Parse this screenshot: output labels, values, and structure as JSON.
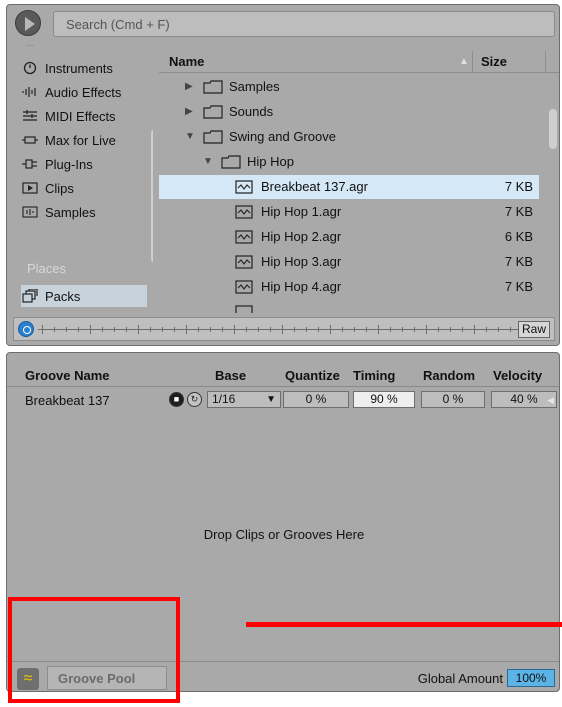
{
  "browser": {
    "search_placeholder": "Search (Cmd + F)",
    "sidebar": {
      "categories": [
        {
          "label": "Instruments",
          "icon": "clock-icon"
        },
        {
          "label": "Audio Effects",
          "icon": "waveform-icon"
        },
        {
          "label": "MIDI Effects",
          "icon": "midi-icon"
        },
        {
          "label": "Max for Live",
          "icon": "max-icon"
        },
        {
          "label": "Plug-Ins",
          "icon": "plug-icon"
        },
        {
          "label": "Clips",
          "icon": "clip-icon"
        },
        {
          "label": "Samples",
          "icon": "sample-icon"
        }
      ],
      "places_heading": "Places",
      "places": [
        {
          "label": "Packs",
          "icon": "packs-icon",
          "selected": true
        }
      ]
    },
    "list": {
      "col_name": "Name",
      "col_size": "Size",
      "rows": [
        {
          "label": "Samples",
          "type": "folder",
          "expanded": false
        },
        {
          "label": "Sounds",
          "type": "folder",
          "expanded": false
        },
        {
          "label": "Swing and Groove",
          "type": "folder",
          "expanded": true
        },
        {
          "label": "Hip Hop",
          "type": "folder",
          "expanded": true
        },
        {
          "label": "Breakbeat 137.agr",
          "type": "groove",
          "size": "7 KB",
          "selected": true
        },
        {
          "label": "Hip Hop 1.agr",
          "type": "groove",
          "size": "7 KB"
        },
        {
          "label": "Hip Hop 2.agr",
          "type": "groove",
          "size": "6 KB"
        },
        {
          "label": "Hip Hop 3.agr",
          "type": "groove",
          "size": "7 KB"
        },
        {
          "label": "Hip Hop 4.agr",
          "type": "groove",
          "size": "7 KB"
        }
      ]
    },
    "preview": {
      "raw_label": "Raw"
    }
  },
  "groove_pool": {
    "columns": {
      "name": "Groove Name",
      "base": "Base",
      "quantize": "Quantize",
      "timing": "Timing",
      "random": "Random",
      "velocity": "Velocity"
    },
    "rows": [
      {
        "name": "Breakbeat 137",
        "base": "1/16",
        "quantize": "0 %",
        "timing": "90 %",
        "random": "0 %",
        "velocity": "40 %"
      }
    ],
    "drop_text": "Drop Clips or Grooves Here",
    "footer": {
      "label": "Groove Pool",
      "global_amount_label": "Global Amount",
      "global_amount_value": "100%"
    }
  },
  "colors": {
    "panel": "#a9a9a9",
    "selection": "#d4e8f7",
    "accent_blue": "#5bb3e6",
    "groove_icon": "#f2c200",
    "annotation_red": "#ff0000"
  }
}
